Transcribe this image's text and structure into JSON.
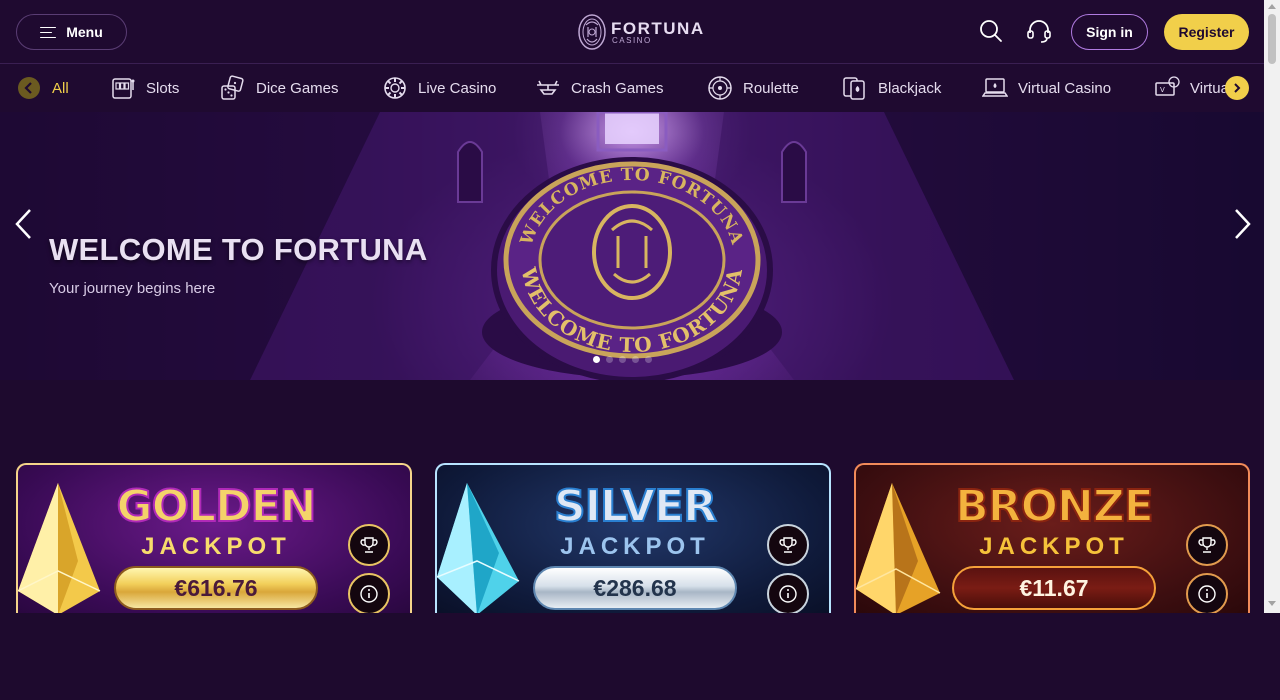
{
  "header": {
    "menu_label": "Menu",
    "logo_main": "FORTUNA",
    "logo_sub": "CASINO",
    "signin_label": "Sign in",
    "register_label": "Register"
  },
  "categories": [
    {
      "label": "All",
      "icon": "all-icon",
      "active": true
    },
    {
      "label": "Slots",
      "icon": "slot-machine-icon"
    },
    {
      "label": "Dice Games",
      "icon": "dice-icon"
    },
    {
      "label": "Live Casino",
      "icon": "chip-icon"
    },
    {
      "label": "Crash Games",
      "icon": "plane-icon"
    },
    {
      "label": "Roulette",
      "icon": "roulette-icon"
    },
    {
      "label": "Blackjack",
      "icon": "cards-icon"
    },
    {
      "label": "Virtual Casino",
      "icon": "laptop-icon"
    },
    {
      "label": "Virtua",
      "icon": "virtual-icon"
    }
  ],
  "hero": {
    "title": "WELCOME TO FORTUNA",
    "subtitle": "Your journey begins here",
    "medallion_text": "WELCOME TO FORTUNA",
    "slide_count": 5,
    "active_slide": 1
  },
  "jackpots": [
    {
      "name": "GOLDEN",
      "label": "JACKPOT",
      "amount": "€616.76",
      "theme": "gold"
    },
    {
      "name": "SILVER",
      "label": "JACKPOT",
      "amount": "€286.68",
      "theme": "silver"
    },
    {
      "name": "BRONZE",
      "label": "JACKPOT",
      "amount": "€11.67",
      "theme": "bronze"
    }
  ],
  "colors": {
    "accent": "#f1cf4a",
    "background": "#1e0a2e",
    "header": "#1f0a30"
  }
}
